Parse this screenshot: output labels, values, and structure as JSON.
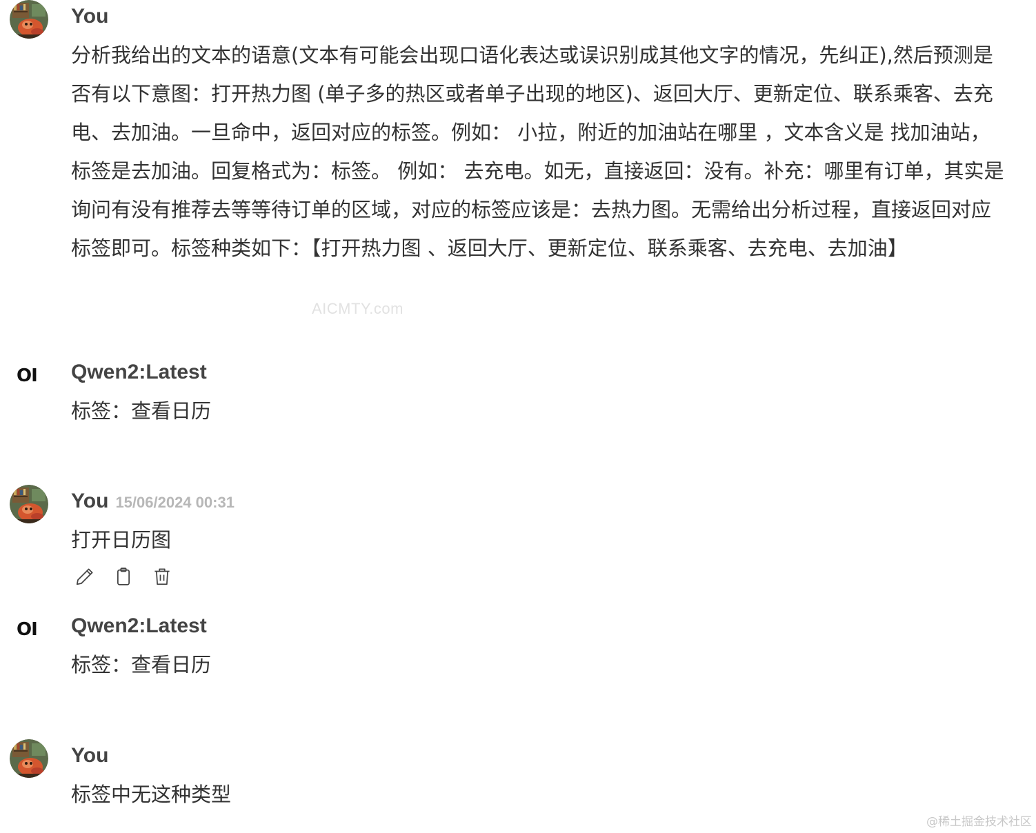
{
  "messages": [
    {
      "role": "user",
      "name": "You",
      "timestamp": "",
      "text": "分析我给出的文本的语意(文本有可能会出现口语化表达或误识别成其他文字的情况，先纠正),然后预测是否有以下意图：打开热力图 (单子多的热区或者单子出现的地区)、返回大厅、更新定位、联系乘客、去充电、去加油。一旦命中，返回对应的标签。例如： 小拉，附近的加油站在哪里 ，文本含义是 找加油站，标签是去加油。回复格式为：标签。 例如： 去充电。如无，直接返回：没有。补充：哪里有订单，其实是询问有没有推荐去等等待订单的区域，对应的标签应该是：去热力图。无需给出分析过程，直接返回对应标签即可。标签种类如下：【打开热力图 、返回大厅、更新定位、联系乘客、去充电、去加油】"
    },
    {
      "role": "assistant",
      "name": "Qwen2:Latest",
      "logo": "OI",
      "text": "标签：查看日历"
    },
    {
      "role": "user",
      "name": "You",
      "timestamp": "15/06/2024 00:31",
      "text": "打开日历图"
    },
    {
      "role": "assistant",
      "name": "Qwen2:Latest",
      "logo": "OI",
      "text": "标签：查看日历"
    },
    {
      "role": "user",
      "name": "You",
      "timestamp": "",
      "text": "标签中无这种类型"
    }
  ],
  "actions": {
    "edit_icon": "pencil-icon",
    "copy_icon": "clipboard-icon",
    "delete_icon": "trash-icon"
  },
  "watermarks": {
    "center": "AICMTY.com",
    "corner": "@稀土掘金技术社区"
  },
  "colors": {
    "name": "#444444",
    "timestamp": "#b7b7b7",
    "text": "#333333",
    "background": "#ffffff"
  }
}
